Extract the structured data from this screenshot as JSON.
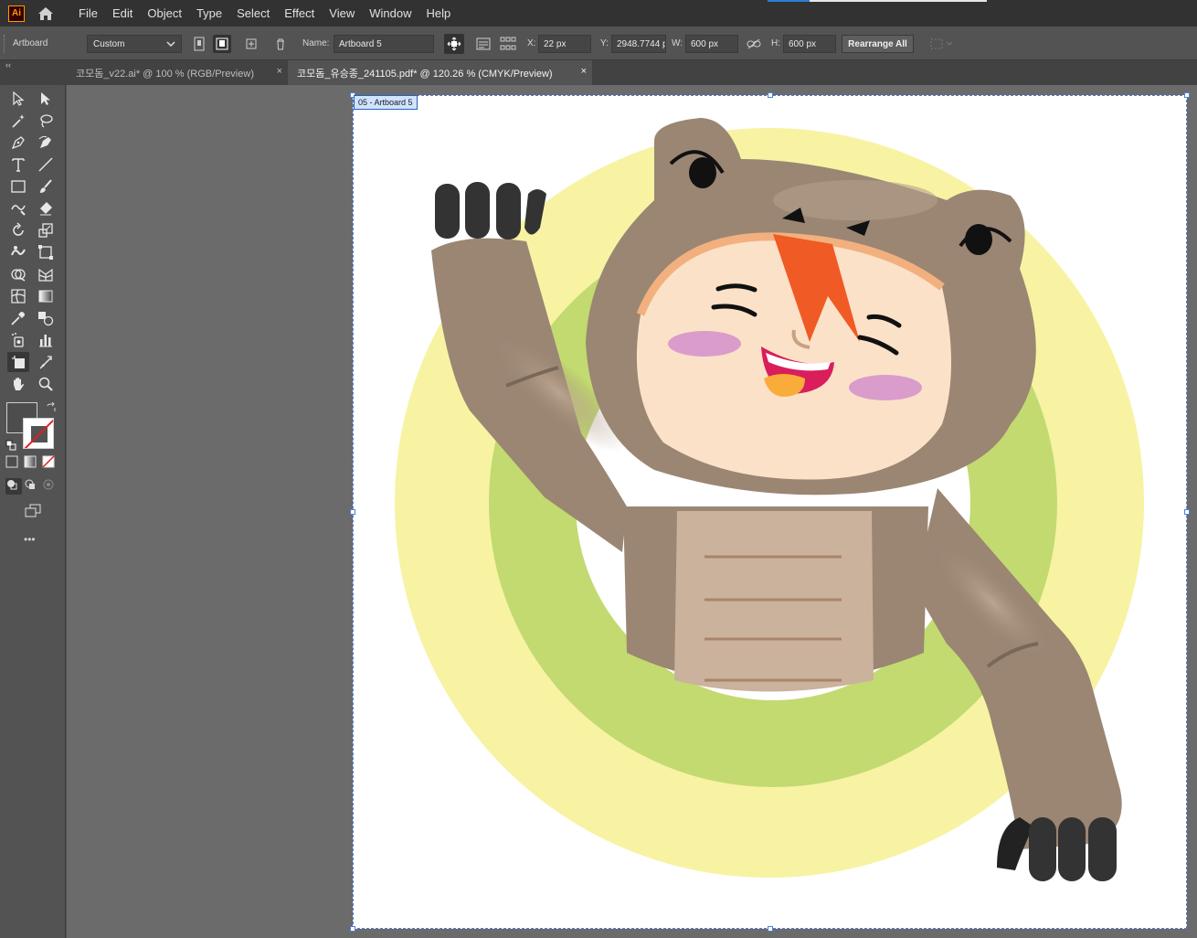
{
  "app": {
    "logo_text": "Ai"
  },
  "menu": {
    "items": [
      "File",
      "Edit",
      "Object",
      "Type",
      "Select",
      "Effect",
      "View",
      "Window",
      "Help"
    ]
  },
  "controlbar": {
    "context_label": "Artboard",
    "preset_value": "Custom",
    "name_label": "Name:",
    "name_value": "Artboard 5",
    "x_label": "X:",
    "x_value": "22 px",
    "y_label": "Y:",
    "y_value": "2948.7744 p",
    "w_label": "W:",
    "w_value": "600 px",
    "h_label": "H:",
    "h_value": "600 px",
    "rearrange_label": "Rearrange All"
  },
  "tabs": [
    {
      "label": "코모돔_v22.ai* @ 100 % (RGB/Preview)",
      "active": false,
      "close": "×"
    },
    {
      "label": "코모돔_유승종_241105.pdf* @ 120.26 % (CMYK/Preview)",
      "active": true,
      "close": "×"
    }
  ],
  "toolbar": {
    "more_label": "•••",
    "tools": [
      "selection-tool",
      "direct-selection-tool",
      "magic-wand-tool",
      "lasso-tool",
      "pen-tool",
      "curvature-tool",
      "type-tool",
      "line-tool",
      "rectangle-tool",
      "paintbrush-tool",
      "shaper-tool",
      "eraser-tool",
      "rotate-tool",
      "scale-tool",
      "warp-tool",
      "free-transform-tool",
      "shape-builder-tool",
      "perspective-grid-tool",
      "mesh-tool",
      "gradient-tool",
      "eyedropper-tool",
      "blend-tool",
      "symbol-sprayer-tool",
      "column-graph-tool",
      "artboard-tool",
      "slice-tool",
      "hand-tool",
      "zoom-tool"
    ],
    "fill_color": "#4d4d4d",
    "stroke_color": "none"
  },
  "canvas": {
    "artboard_label": "05 - Artboard 5",
    "colors": {
      "pasteboard": "#6b6b6b",
      "ring_outer": "#f7f3a3",
      "ring_inner": "#c2da70",
      "costume": "#9a8673",
      "face": "#fbe1c8",
      "belly": "#cbb29c",
      "claws": "#333333",
      "cheeks": "#d99ccb",
      "horn": "#f05a24",
      "tongue": "#f9ac3a",
      "mouth": "#d91e5b"
    }
  }
}
